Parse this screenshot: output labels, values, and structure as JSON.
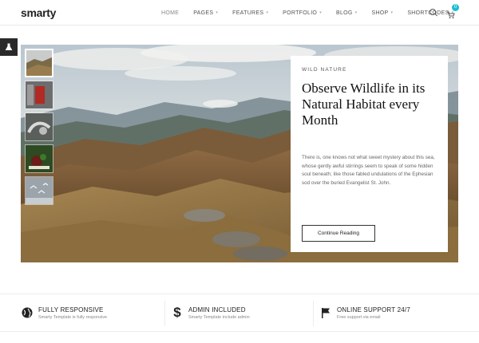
{
  "header": {
    "logo": "smarty",
    "nav": [
      {
        "label": "HOME",
        "active": true,
        "has_caret": false
      },
      {
        "label": "PAGES",
        "active": false,
        "has_caret": true
      },
      {
        "label": "FEATURES",
        "active": false,
        "has_caret": true
      },
      {
        "label": "PORTFOLIO",
        "active": false,
        "has_caret": true
      },
      {
        "label": "BLOG",
        "active": false,
        "has_caret": true
      },
      {
        "label": "SHOP",
        "active": false,
        "has_caret": true
      },
      {
        "label": "SHORTCODES",
        "active": false,
        "has_caret": true
      }
    ],
    "cart_count": "0",
    "icons": [
      "search-icon",
      "cart-icon"
    ],
    "accent": "#1bbdd4"
  },
  "side_tab": {
    "icon": "flask-icon"
  },
  "slider": {
    "thumbnails": [
      "mountain-landscape",
      "red-object",
      "pipes",
      "berries",
      "birds"
    ],
    "active_thumbnail": 0,
    "card": {
      "eyebrow": "WILD NATURE",
      "title": "Observe Wildlife in its Natural Habitat every Month",
      "text": "There is, one knows not what sweet mystery about this sea, whose gently awful stirrings seem to speak of some hidden soul beneath; like those fabled undulations of the Ephesian sod over the buried Evangelist St. John.",
      "button": "Continue Reading"
    }
  },
  "features": [
    {
      "icon": "globe-icon",
      "title": "FULLY RESPONSIVE",
      "subtitle": "Smarty Template is fully responsive"
    },
    {
      "icon": "dollar-icon",
      "title": "ADMIN INCLUDED",
      "subtitle": "Smarty Template include admin"
    },
    {
      "icon": "flag-icon",
      "title": "ONLINE SUPPORT 24/7",
      "subtitle": "Free support via email"
    }
  ]
}
